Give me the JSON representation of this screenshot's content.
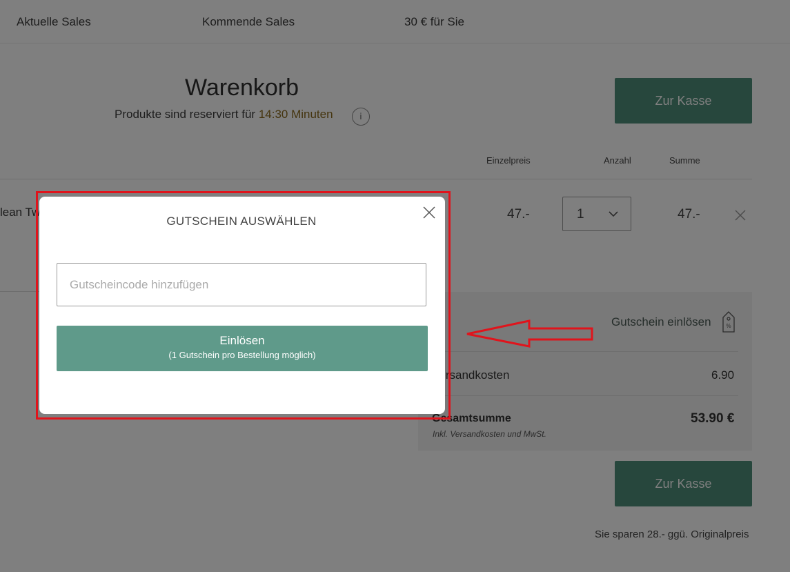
{
  "nav": {
    "items": [
      "Aktuelle Sales",
      "Kommende Sales",
      "30 € für Sie"
    ]
  },
  "cart": {
    "title": "Warenkorb",
    "reserved_prefix": "Produkte sind reserviert für ",
    "reserved_time": "14:30 Minuten",
    "info_icon": "i",
    "checkout_label": "Zur Kasse",
    "columns": {
      "unit_price": "Einzelpreis",
      "quantity": "Anzahl",
      "total": "Summe"
    },
    "item": {
      "name_partial": "lean Tw",
      "price": "47.-",
      "quantity": "1",
      "sum": "47.-"
    }
  },
  "summary": {
    "voucher_link": "Gutschein einlösen",
    "shipping_label": "Versandkosten",
    "shipping_value": "6.90",
    "total_label": "Gesamtsumme",
    "total_value": "53.90 €",
    "total_note": "Inkl. Versandkosten und MwSt.",
    "checkout_label": "Zur Kasse",
    "savings": "Sie sparen 28.- ggü. Originalpreis"
  },
  "modal": {
    "title": "GUTSCHEIN AUSWÄHLEN",
    "input_placeholder": "Gutscheincode hinzufügen",
    "input_value": "",
    "redeem_label": "Einlösen",
    "redeem_sub": "(1 Gutschein pro Bestellung möglich)"
  },
  "annotation": {
    "highlight_color": "#e0141c"
  },
  "colors": {
    "accent": "#4f8e7b",
    "redeem_button": "#5f9a8a",
    "timer": "#8a6a1e"
  },
  "icons": [
    "info-icon",
    "chevron-down-icon",
    "close-icon",
    "voucher-tag-icon",
    "arrow-left-icon"
  ]
}
